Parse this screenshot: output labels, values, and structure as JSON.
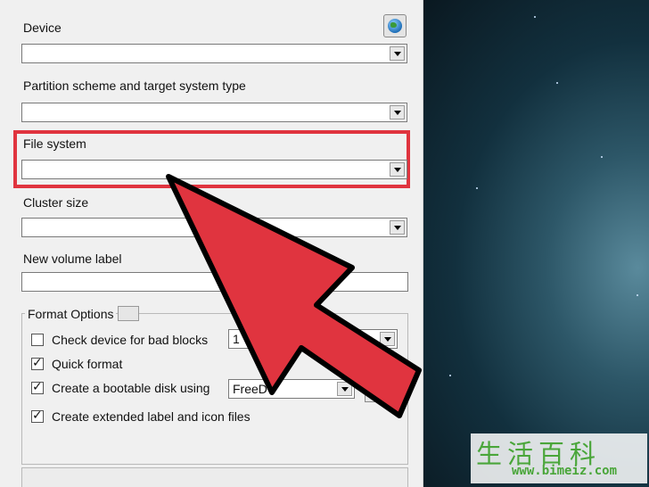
{
  "labels": {
    "device": "Device",
    "partition": "Partition scheme and target system type",
    "file_system": "File system",
    "cluster_size": "Cluster size",
    "volume_label": "New volume label",
    "format_options": "Format Options"
  },
  "options": {
    "bad_blocks": {
      "label": "Check device for bad blocks",
      "checked": false,
      "passes": "1"
    },
    "quick_format": {
      "label": "Quick format",
      "checked": true
    },
    "bootable": {
      "label": "Create a bootable disk using",
      "checked": true,
      "type": "FreeD"
    },
    "extended_label": {
      "label": "Create extended label and icon files",
      "checked": true
    }
  },
  "icons": {
    "device_refresh": "globe-icon",
    "dropdown": "chevron-down-icon",
    "highlight": "red-arrow-pointer"
  },
  "watermark": {
    "characters": "生活百科",
    "url": "www.bimeiz.com"
  },
  "colors": {
    "highlight": "#e0343f",
    "watermark": "#4aa63a",
    "panel": "#f0f0f0"
  }
}
